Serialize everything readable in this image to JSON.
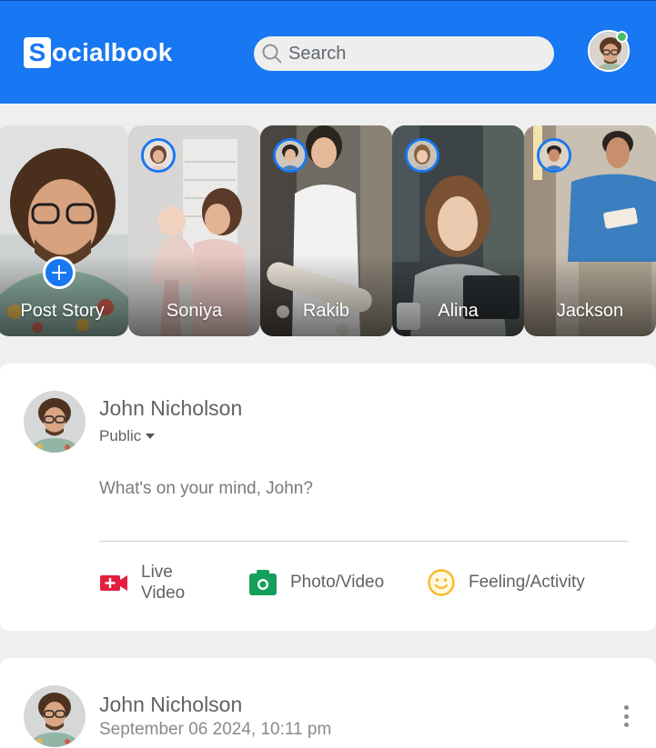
{
  "header": {
    "logo_letter": "S",
    "logo_text": "ocialbook",
    "search_placeholder": "Search",
    "online_color": "#45bd62",
    "brand_color": "#1877f2"
  },
  "stories": [
    {
      "label": "Post Story",
      "icon": "plus-icon"
    },
    {
      "label": "Soniya"
    },
    {
      "label": "Rakib"
    },
    {
      "label": "Alina"
    },
    {
      "label": "Jackson"
    }
  ],
  "composer": {
    "user_name": "John Nicholson",
    "privacy": "Public",
    "prompt": "What's on your mind, John?",
    "actions": [
      {
        "label_line1": "Live",
        "label_line2": "Video",
        "icon": "live-video-icon",
        "color": "#e41e3f"
      },
      {
        "label": "Photo/Video",
        "icon": "camera-icon",
        "color": "#12a05c"
      },
      {
        "label": "Feeling/Activity",
        "icon": "smiley-icon",
        "color": "#f7b928"
      }
    ]
  },
  "post": {
    "user_name": "John Nicholson",
    "date": "September 06 2024, 10:11 pm"
  }
}
